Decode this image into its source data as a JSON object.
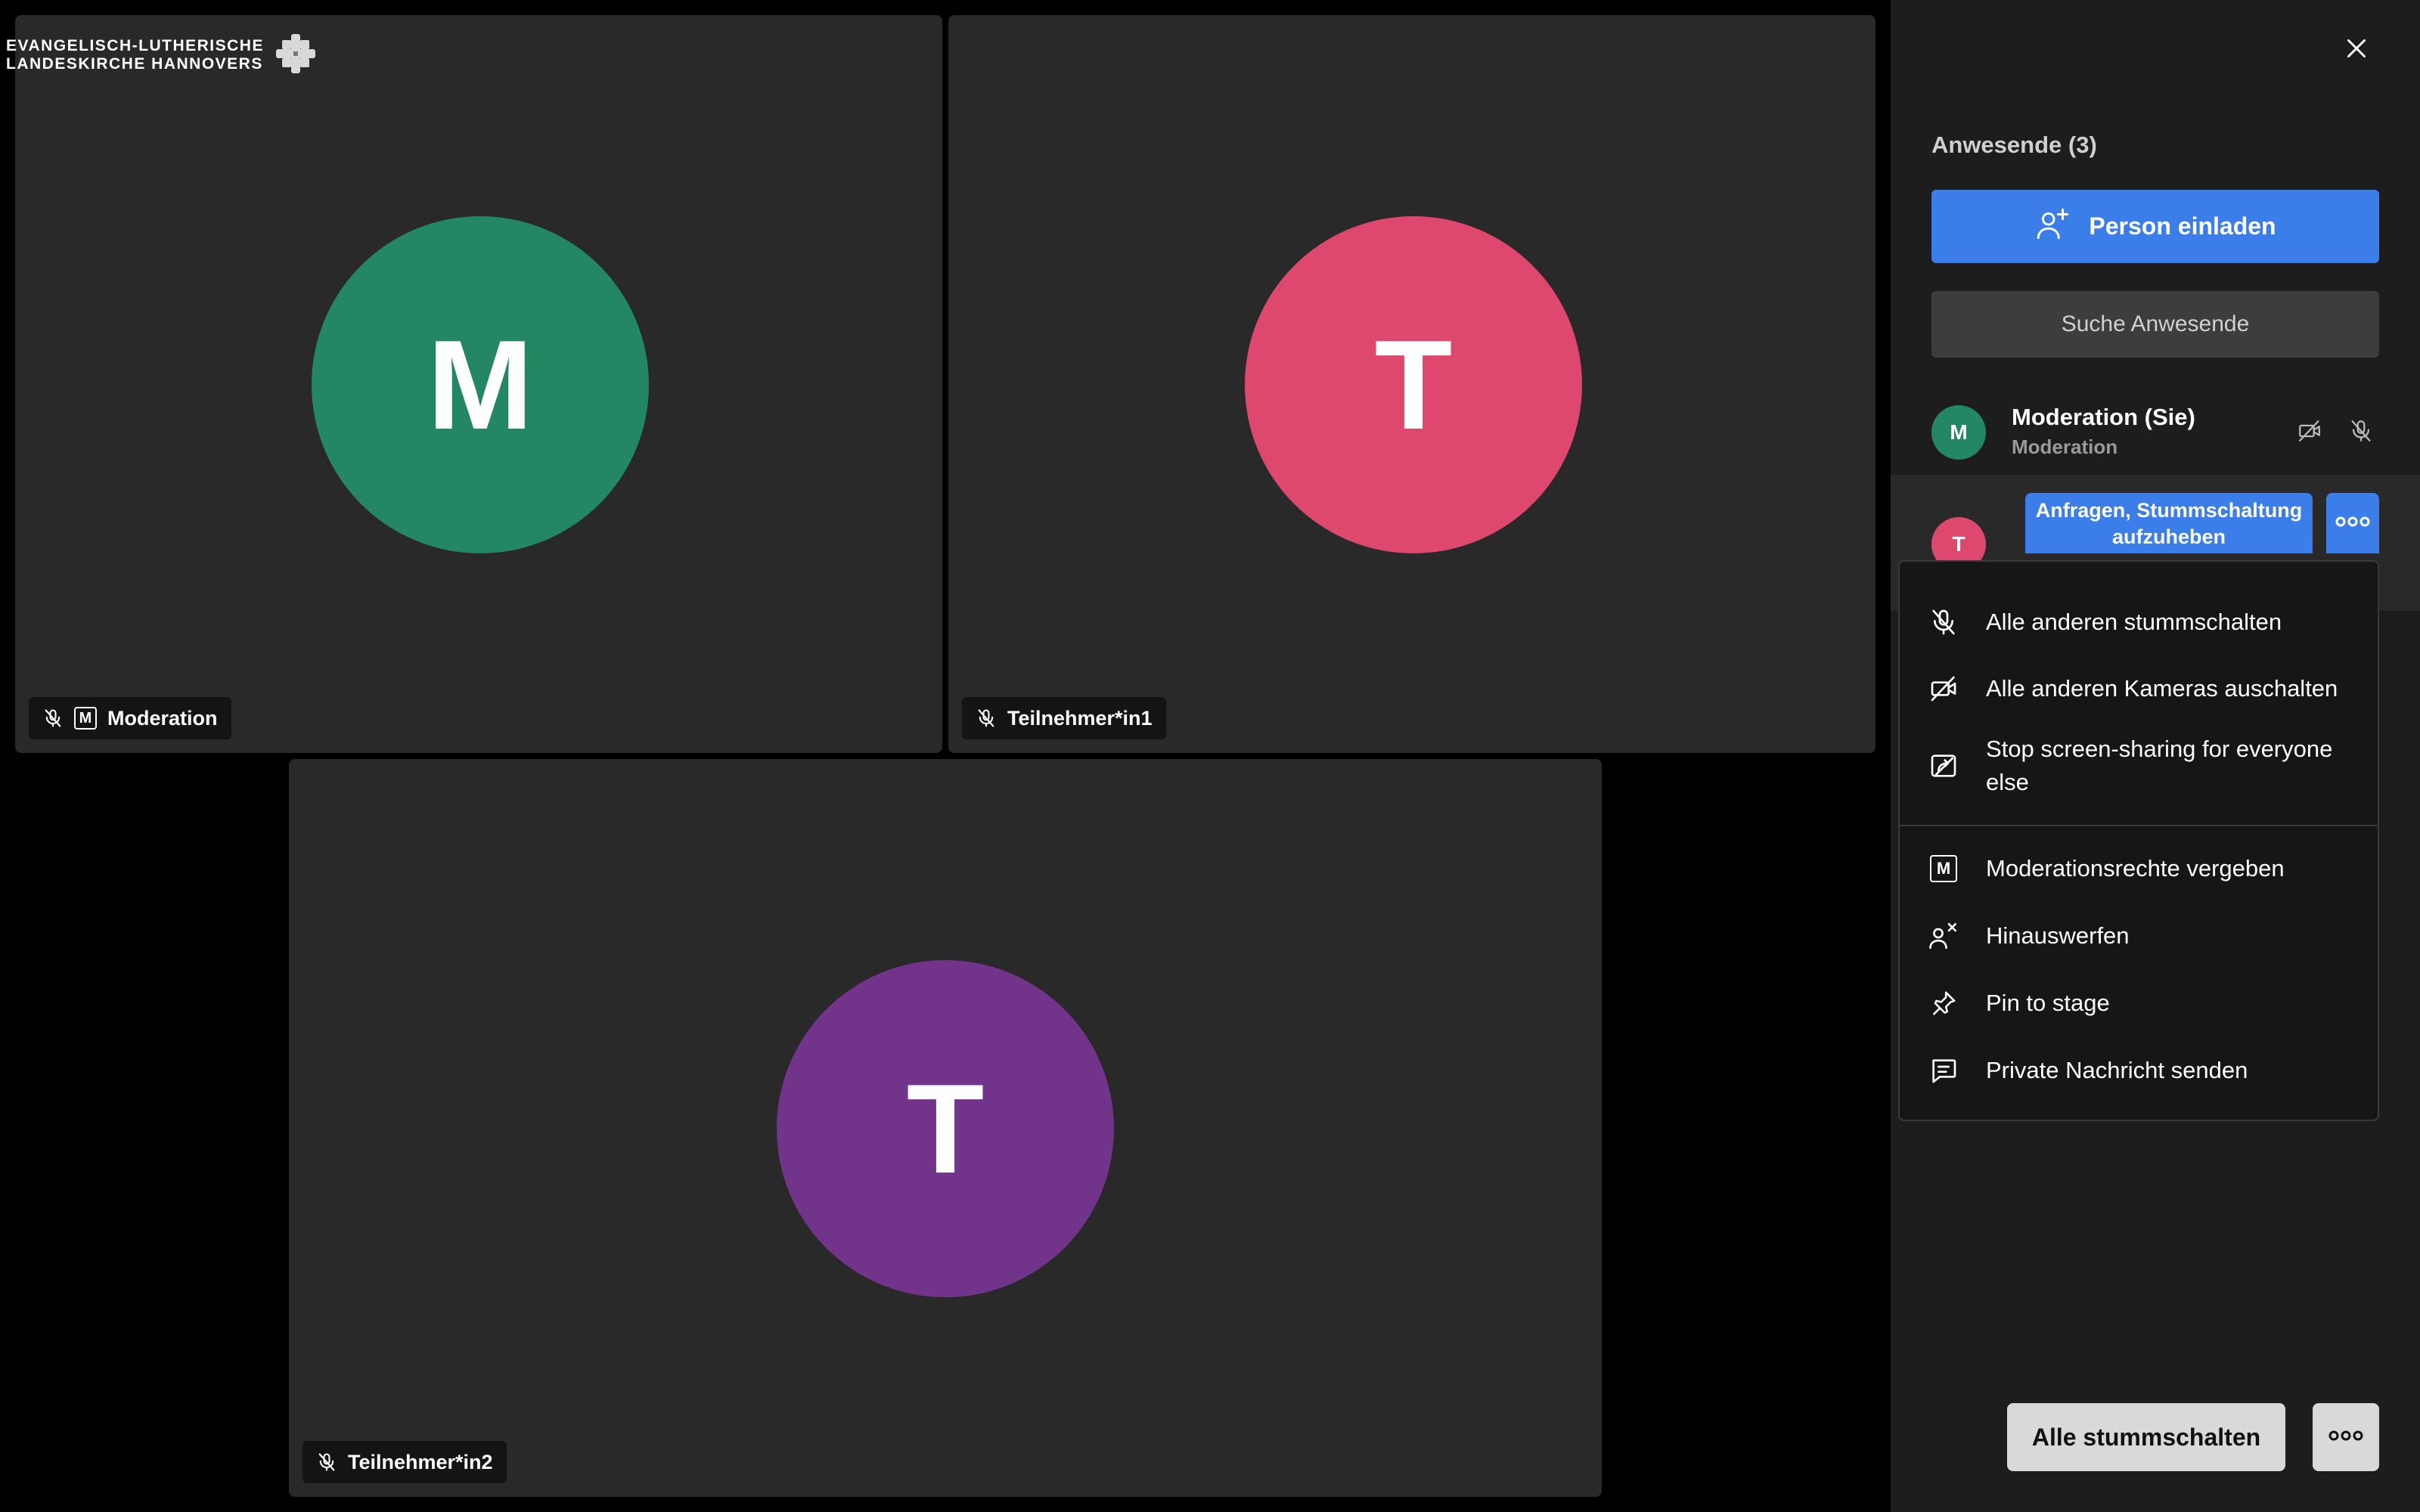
{
  "logo": {
    "line1": "EVANGELISCH-LUTHERISCHE",
    "line2": "LANDESKIRCHE HANNOVERS"
  },
  "tiles": [
    {
      "initial": "M",
      "name": "Moderation",
      "color": "#228762",
      "badge": "M"
    },
    {
      "initial": "T",
      "name": "Teilnehmer*in1",
      "color": "#de476e"
    },
    {
      "initial": "T",
      "name": "Teilnehmer*in2",
      "color": "#72338a"
    }
  ],
  "sidebar": {
    "title": "Anwesende (3)",
    "invite_label": "Person einladen",
    "search_placeholder": "Suche Anwesende",
    "participants": [
      {
        "initial": "M",
        "name": "Moderation (Sie)",
        "role": "Moderation",
        "color": "#228762"
      },
      {
        "initial": "T",
        "action_label": "Anfragen, Stummschaltung aufzuheben",
        "color": "#de476e"
      }
    ],
    "mute_all_label": "Alle stummschalten"
  },
  "context_menu": {
    "items": [
      {
        "label": "Alle anderen stummschalten",
        "icon": "mic-off-icon"
      },
      {
        "label": "Alle anderen Kameras auschalten",
        "icon": "camera-off-icon"
      },
      {
        "label": "Stop screen-sharing for everyone else",
        "icon": "screen-share-off-icon"
      },
      {
        "label": "Moderationsrechte vergeben",
        "icon": "moderator-icon",
        "badge": "M"
      },
      {
        "label": "Hinauswerfen",
        "icon": "kick-user-icon"
      },
      {
        "label": "Pin to stage",
        "icon": "pin-icon"
      },
      {
        "label": "Private Nachricht senden",
        "icon": "chat-icon"
      }
    ]
  },
  "colors": {
    "accent": "#3b7de9",
    "sidebar_bg": "#1d1d1d",
    "tile_bg": "#292929"
  }
}
